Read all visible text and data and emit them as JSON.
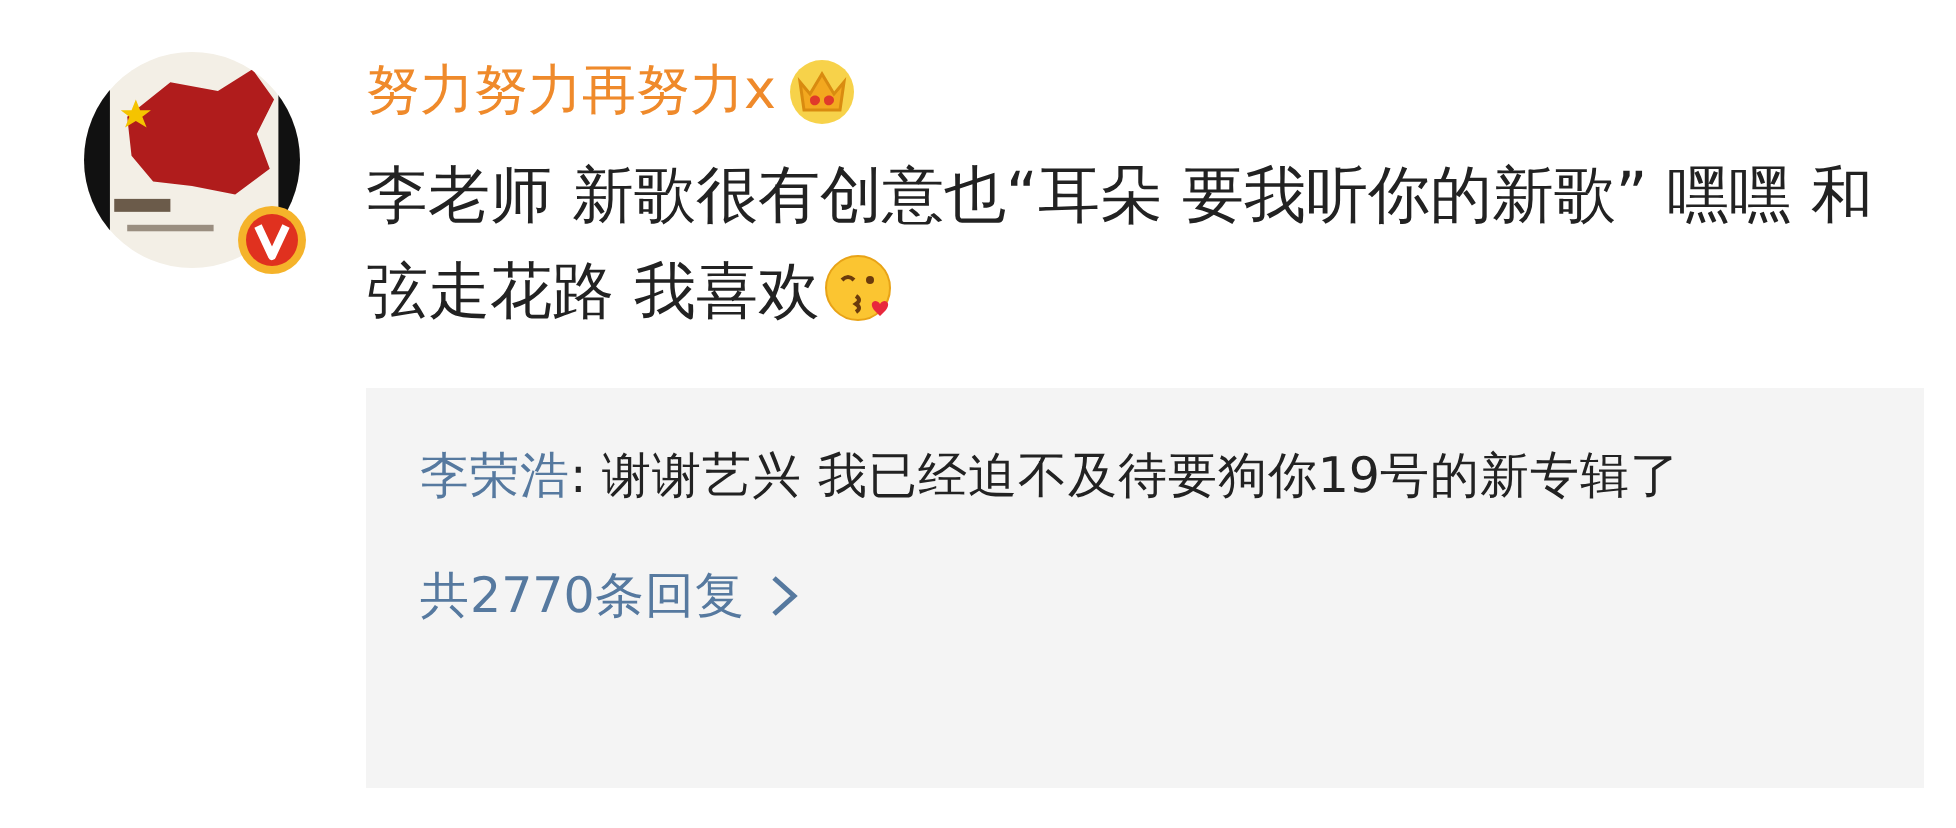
{
  "comment": {
    "author": "努力努力再努力x",
    "text": "李老师 新歌很有创意也“耳朵 要我听你的新歌” 嘿嘿 和弦走花路 我喜欢",
    "verified": true
  },
  "replies": [
    {
      "author": "李荣浩",
      "text": ": 谢谢艺兴 我已经迫不及待要狗你19号的新专辑了"
    }
  ],
  "reply_count": "共2770条回复"
}
